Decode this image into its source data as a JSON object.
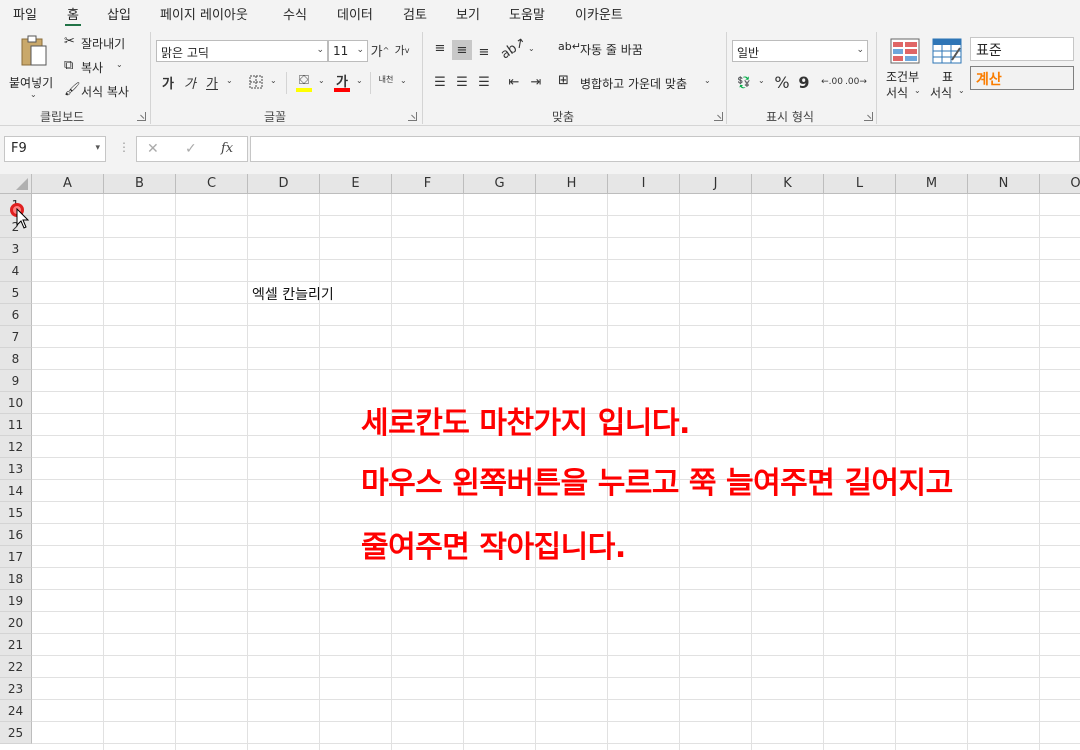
{
  "menu": {
    "tabs": [
      "파일",
      "홈",
      "삽입",
      "페이지 레이아웃",
      "수식",
      "데이터",
      "검토",
      "보기",
      "도움말",
      "이카운트"
    ],
    "active": "홈"
  },
  "ribbon": {
    "clipboard": {
      "paste": "붙여넣기",
      "cut": "잘라내기",
      "copy": "복사",
      "format_painter": "서식 복사",
      "group_label": "클립보드"
    },
    "font": {
      "font_name": "맑은 고딕",
      "font_size": "11",
      "grow": "가",
      "shrink": "가",
      "bold": "가",
      "italic": "가",
      "underline": "가",
      "font_color_glyph": "가",
      "phonetic": "내천",
      "group_label": "글꼴",
      "fill_color": "#ffff00",
      "font_color": "#ff0000"
    },
    "alignment": {
      "wrap_text": "자동 줄 바꿈",
      "merge_center": "병합하고 가운데 맞춤",
      "group_label": "맞춤"
    },
    "number": {
      "format": "일반",
      "percent": "%",
      "comma": "9",
      "inc_decimal": ".00",
      "dec_decimal": ".00",
      "group_label": "표시 형식"
    },
    "styles": {
      "conditional": [
        "조건부",
        "서식"
      ],
      "table": [
        "표",
        "서식"
      ],
      "style_normal": "표준",
      "style_calc": "계산"
    }
  },
  "formula_bar": {
    "name_box": "F9",
    "cancel": "✕",
    "enter": "✓",
    "fx": "fx",
    "content": ""
  },
  "grid": {
    "columns": [
      "A",
      "B",
      "C",
      "D",
      "E",
      "F",
      "G",
      "H",
      "I",
      "J",
      "K",
      "L",
      "M",
      "N",
      "O"
    ],
    "rows": [
      "1",
      "2",
      "3",
      "4",
      "5",
      "6",
      "7",
      "8",
      "9",
      "10",
      "11",
      "12",
      "13",
      "14",
      "15",
      "16",
      "17",
      "18",
      "19",
      "20",
      "21",
      "22",
      "23",
      "24",
      "25"
    ],
    "cell_D5": "엑셀 칸늘리기"
  },
  "annotation": {
    "line1": "세로칸도 마찬가지 입니다.",
    "line2": "마우스 왼쪽버튼을 누르고 쭉 늘여주면 길어지고",
    "line3": "줄여주면 작아집니다.",
    "color": "#ff0000"
  }
}
